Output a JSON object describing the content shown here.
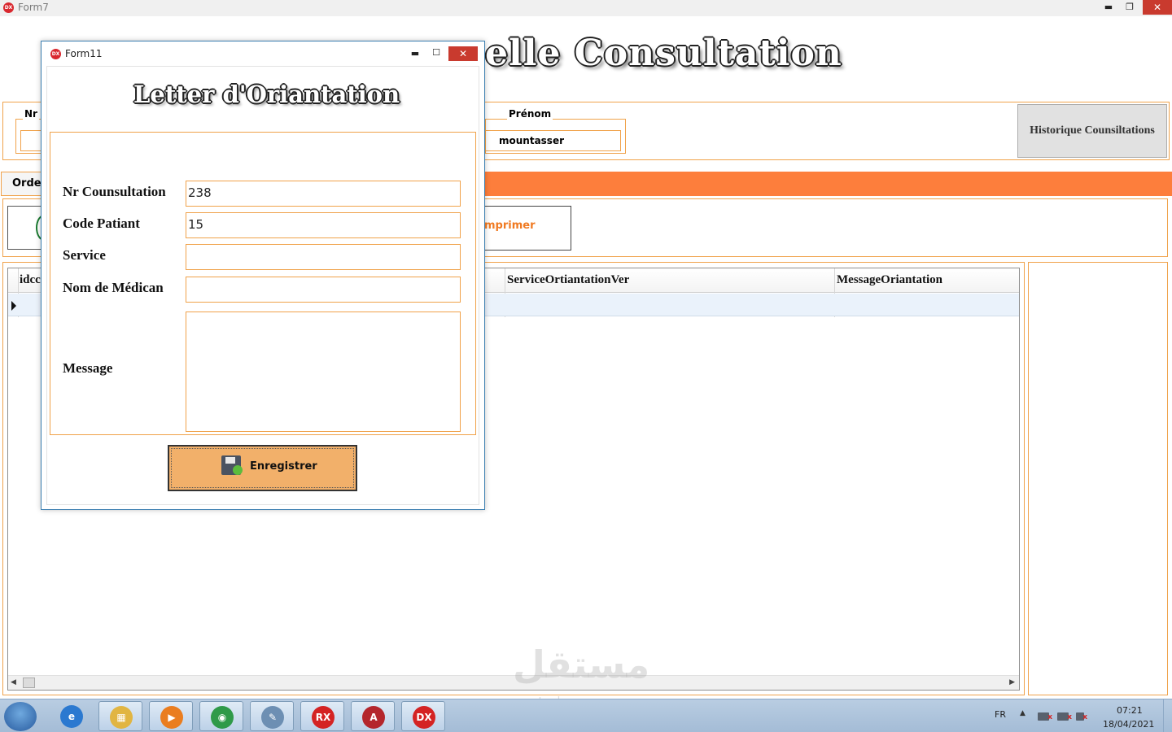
{
  "main_window": {
    "icon_text": "DX",
    "title": "Form7",
    "minimize": "▬",
    "restore": "❐",
    "close": "✕",
    "heading": "elle Consultation",
    "group_nr_legend": "Nr",
    "group_prenom_legend": "Prénom",
    "prenom_value": "mountasser",
    "historique_button": "Historique Counsiltations",
    "tab_label": "Order",
    "imprimer_button": "mprimer",
    "grid": {
      "columns": [
        "idcc",
        "ServiceOrtiantationVer",
        "MessageOriantation"
      ]
    }
  },
  "dialog": {
    "icon_text": "DX",
    "title": "Form11",
    "minimize": "▬",
    "maximize": "☐",
    "close": "✕",
    "heading": "Letter d'Oriantation",
    "fields": {
      "nr_consultation": {
        "label": "Nr Counsultation",
        "value": "238"
      },
      "code_patient": {
        "label": "Code Patiant",
        "value": "15"
      },
      "service": {
        "label": "Service",
        "value": ""
      },
      "nom_medecin": {
        "label": "Nom de Médican",
        "value": ""
      },
      "message": {
        "label": "Message",
        "value": ""
      }
    },
    "save_button": "Enregistrer"
  },
  "taskbar": {
    "apps": [
      {
        "name": "internet-explorer",
        "glyph": "e",
        "color": "#2b79d0"
      },
      {
        "name": "file-explorer",
        "glyph": "▦",
        "color": "#e1b542"
      },
      {
        "name": "media-player",
        "glyph": "▶",
        "color": "#ea7d1f"
      },
      {
        "name": "chrome",
        "glyph": "◉",
        "color": "#2f9a49"
      },
      {
        "name": "notepad",
        "glyph": "✎",
        "color": "#6d8fb3"
      },
      {
        "name": "rx-app",
        "glyph": "RX",
        "color": "#d42323"
      },
      {
        "name": "access",
        "glyph": "A",
        "color": "#b4262c"
      },
      {
        "name": "dx-app",
        "glyph": "DX",
        "color": "#d42323"
      }
    ],
    "language": "FR",
    "tray_up": "▲",
    "time": "07:21",
    "date": "18/04/2021"
  },
  "watermark": {
    "text": "مستقل",
    "sub": "mostaql.com"
  }
}
